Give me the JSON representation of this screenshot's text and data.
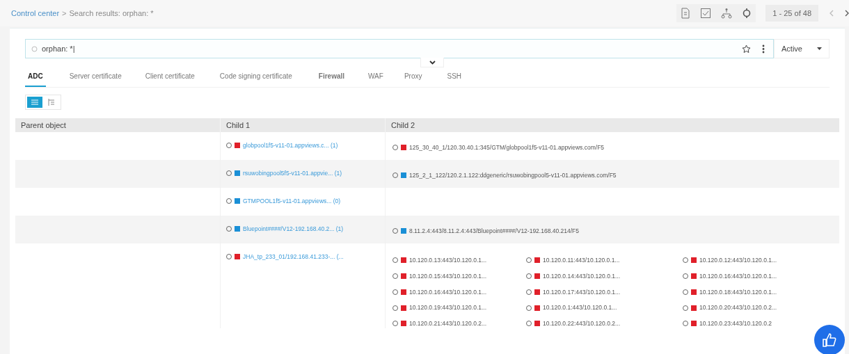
{
  "breadcrumb": {
    "link": "Control center",
    "separator": ">",
    "current": "Search results: orphan: *"
  },
  "pagination": {
    "range": "1 - 25 of 48"
  },
  "search": {
    "value": "orphan: *|"
  },
  "status_filter": {
    "value": "Active"
  },
  "filter_panel": {
    "expanded": false
  },
  "tabs": [
    {
      "label": "ADC",
      "selected": true,
      "bold": false
    },
    {
      "label": "Server certificate",
      "selected": false,
      "bold": false
    },
    {
      "label": "Client certificate",
      "selected": false,
      "bold": false
    },
    {
      "label": "Code signing certificate",
      "selected": false,
      "bold": false
    },
    {
      "label": "Firewall",
      "selected": false,
      "bold": true
    },
    {
      "label": "WAF",
      "selected": false,
      "bold": false
    },
    {
      "label": "Proxy",
      "selected": false,
      "bold": false
    },
    {
      "label": "SSH",
      "selected": false,
      "bold": false
    }
  ],
  "view_toggle": [
    {
      "kind": "table",
      "selected": true
    },
    {
      "kind": "tree",
      "selected": false
    }
  ],
  "table": {
    "columns": [
      "Parent object",
      "Child 1",
      "Child 2"
    ],
    "rows": [
      {
        "child_1": {
          "text": "globpool1f5-v11-01.appviews.c... (1)",
          "color": "#e0202a"
        },
        "child_2": [
          {
            "text": "125_30_40_1/120.30.40.1:345/GTM/globpool1f5-v11-01.appviews.com/F5",
            "color": "#e0202a"
          }
        ]
      },
      {
        "child_1": {
          "text": "rsuwobingpool5f5-v11-01.appvie... (1)",
          "color": "#1a8fd6"
        },
        "child_2": [
          {
            "text": "125_2_1_122/120.2.1.122:ddgeneric/rsuwobingpool5-v11-01.appviews.com/F5",
            "color": "#1a8fd6"
          }
        ]
      },
      {
        "child_1": {
          "text": "GTMPOOL1f5-v11-01.appviews... (0)",
          "color": "#1a8fd6"
        }
      },
      {
        "child_1": {
          "text": "Bluepoint####/V12-192.168.40.2... (1)",
          "color": "#1a8fd6"
        },
        "child_2": [
          {
            "text": "8.11.2.4:443/8.11.2.4:443/Bluepoint####/V12-192.168.40.214/F5",
            "color": "#1a8fd6"
          }
        ]
      },
      {
        "child_1": {
          "text": "JHA_tp_233_01/192.168.41.233-... (...",
          "color": "#e0202a"
        },
        "child_2": [
          {
            "text": "10.120.0.13:443/10.120.0.1...",
            "color": "#e0202a"
          },
          {
            "text": "10.120.0.11:443/10.120.0.1...",
            "color": "#e0202a"
          },
          {
            "text": "10.120.0.12:443/10.120.0.1...",
            "color": "#e0202a"
          },
          {
            "text": "10.120.0.15:443/10.120.0.1...",
            "color": "#e0202a"
          },
          {
            "text": "10.120.0.14:443/10.120.0.1...",
            "color": "#e0202a"
          },
          {
            "text": "10.120.0.16:443/10.120.0.1...",
            "color": "#e0202a"
          },
          {
            "text": "10.120.0.16:443/10.120.0.1...",
            "color": "#e0202a"
          },
          {
            "text": "10.120.0.17:443/10.120.0.1...",
            "color": "#e0202a"
          },
          {
            "text": "10.120.0.18:443/10.120.0.1...",
            "color": "#e0202a"
          },
          {
            "text": "10.120.0.19:443/10.120.0.1...",
            "color": "#e0202a"
          },
          {
            "text": "10.120.0.1:443/10.120.0.1...",
            "color": "#e0202a"
          },
          {
            "text": "10.120.0.20:443/10.120.0.2...",
            "color": "#e0202a"
          },
          {
            "text": "10.120.0.21:443/10.120.0.2...",
            "color": "#e0202a"
          },
          {
            "text": "10.120.0.22:443/10.120.0.2...",
            "color": "#e0202a"
          },
          {
            "text": "10.120.0.23:443/10.120.0.2",
            "color": "#e0202a"
          }
        ]
      }
    ]
  }
}
